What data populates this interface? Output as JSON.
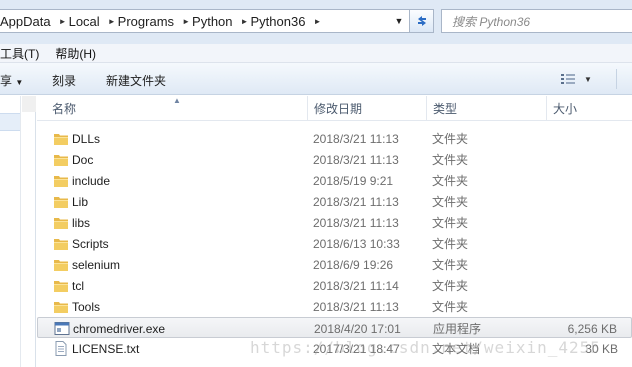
{
  "breadcrumb": [
    "AppData",
    "Local",
    "Programs",
    "Python",
    "Python36"
  ],
  "search": {
    "placeholder": "搜索 Python36"
  },
  "menu": [
    "工具(T)",
    "帮助(H)"
  ],
  "toolbar": {
    "share_label": "享",
    "burn_label": "刻录",
    "new_folder_label": "新建文件夹"
  },
  "columns": {
    "name": "名称",
    "date": "修改日期",
    "type": "类型",
    "size": "大小"
  },
  "files": [
    {
      "name": "DLLs",
      "date": "2018/3/21 11:13",
      "type": "文件夹",
      "size": "",
      "icon": "folder-icon"
    },
    {
      "name": "Doc",
      "date": "2018/3/21 11:13",
      "type": "文件夹",
      "size": "",
      "icon": "folder-icon"
    },
    {
      "name": "include",
      "date": "2018/5/19 9:21",
      "type": "文件夹",
      "size": "",
      "icon": "folder-icon"
    },
    {
      "name": "Lib",
      "date": "2018/3/21 11:13",
      "type": "文件夹",
      "size": "",
      "icon": "folder-icon"
    },
    {
      "name": "libs",
      "date": "2018/3/21 11:13",
      "type": "文件夹",
      "size": "",
      "icon": "folder-icon"
    },
    {
      "name": "Scripts",
      "date": "2018/6/13 10:33",
      "type": "文件夹",
      "size": "",
      "icon": "folder-icon"
    },
    {
      "name": "selenium",
      "date": "2018/6/9 19:26",
      "type": "文件夹",
      "size": "",
      "icon": "folder-icon"
    },
    {
      "name": "tcl",
      "date": "2018/3/21 11:14",
      "type": "文件夹",
      "size": "",
      "icon": "folder-icon"
    },
    {
      "name": "Tools",
      "date": "2018/3/21 11:13",
      "type": "文件夹",
      "size": "",
      "icon": "folder-icon"
    },
    {
      "name": "chromedriver.exe",
      "date": "2018/4/20 17:01",
      "type": "应用程序",
      "size": "6,256 KB",
      "icon": "application-icon"
    },
    {
      "name": "LICENSE.txt",
      "date": "2017/3/21 18:47",
      "type": "文本文档",
      "size": "30 KB",
      "icon": "text-file-icon"
    }
  ],
  "selected_index": 9,
  "watermark": "https://blog.csdn.net/weixin_4255",
  "colors": {
    "folder": "#e8b94a",
    "selection_border": "#c8ccd3",
    "header_text": "#4b5a6e"
  }
}
